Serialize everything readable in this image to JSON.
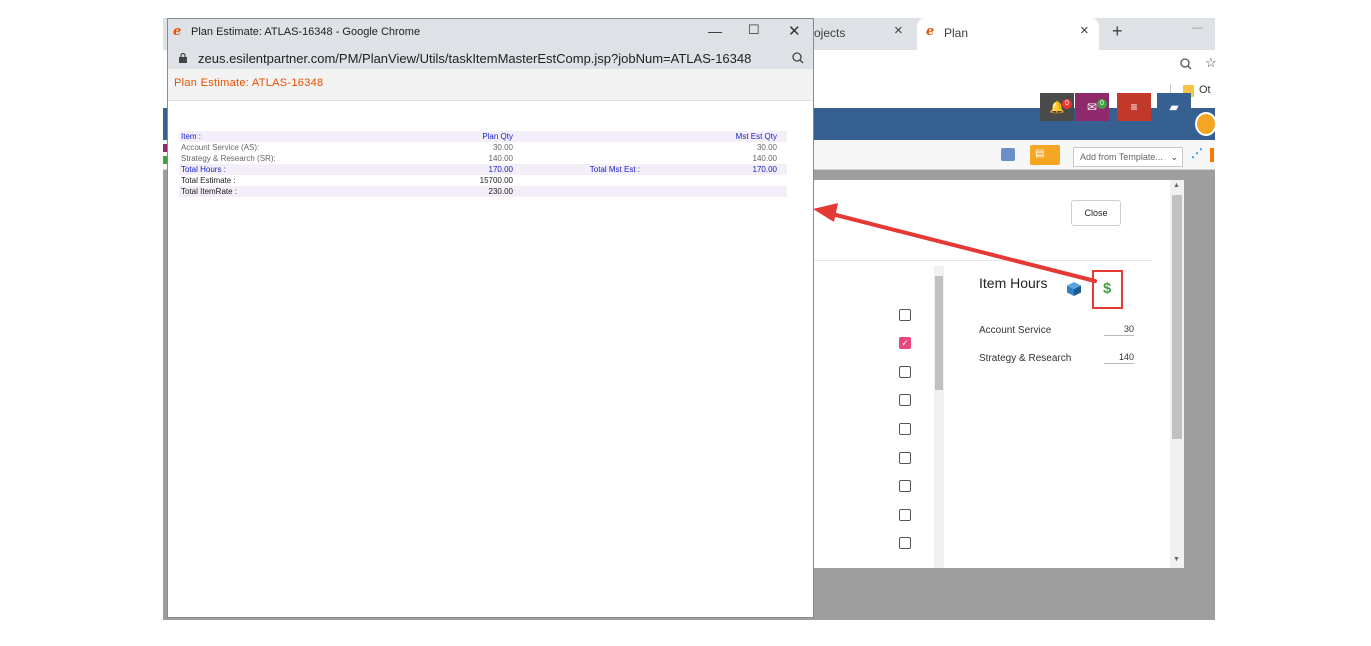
{
  "background_browser": {
    "tabs": [
      {
        "label": "ojects",
        "close": "×"
      },
      {
        "label": "Plan",
        "close": "×"
      }
    ],
    "new_tab": "+",
    "minimize": "—",
    "bookmark_partial": "Ot",
    "toolbar": {
      "template_select": "Add from Template..."
    },
    "appbar_badges": {
      "notifications": "0",
      "messages": "0"
    },
    "modal": {
      "close_label": "Close",
      "item_hours_title": "Item Hours",
      "items": [
        {
          "label": "Account Service",
          "value": "30"
        },
        {
          "label": "Strategy & Research",
          "value": "140"
        }
      ],
      "checkboxes": [
        false,
        true,
        false,
        false,
        false,
        false,
        false,
        false,
        false
      ]
    }
  },
  "popup": {
    "window_title": "Plan Estimate: ATLAS-16348 - Google Chrome",
    "url": "zeus.esilentpartner.com/PM/PlanView/Utils/taskItemMasterEstComp.jsp?jobNum=ATLAS-16348",
    "header_title": "Plan Estimate: ATLAS-16348",
    "table": {
      "header": {
        "item": "Item :",
        "plan_qty": "Plan Qty",
        "mst_est_qty": "Mst Est Qty"
      },
      "rows": [
        {
          "item": "Account Service (AS):",
          "plan_qty": "30.00",
          "mst_est_qty": "30.00"
        },
        {
          "item": "Strategy & Research (SR):",
          "plan_qty": "140.00",
          "mst_est_qty": "140.00"
        }
      ],
      "total_hours": {
        "label": "Total Hours :",
        "plan_qty": "170.00",
        "mst_label": "Total Mst Est :",
        "mst_value": "170.00"
      },
      "total_estimate": {
        "label": "Total Estimate :",
        "value": "15700.00"
      },
      "total_itemrate": {
        "label": "Total ItemRate :",
        "value": "230.00"
      }
    }
  },
  "colors": {
    "accent_orange": "#e65100",
    "table_blue": "#1a23c8",
    "highlight_red": "#e53935",
    "dollar_green": "#43a047",
    "appbar_blue": "#35608f"
  }
}
